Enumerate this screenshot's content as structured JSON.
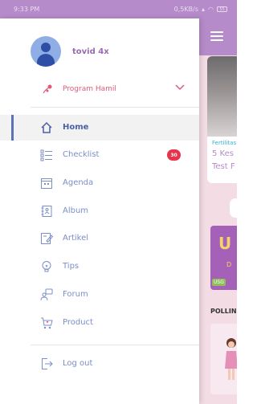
{
  "status_bar": {
    "time": "9:33 PM",
    "network_speed": "0,5KB/s",
    "battery": "55"
  },
  "drawer": {
    "user_name": "tovid 4x",
    "program_label": "Program Hamil",
    "nav_items": [
      {
        "label": "Home",
        "icon": "home-icon",
        "active": true
      },
      {
        "label": "Checklist",
        "icon": "checklist-icon",
        "badge": "30"
      },
      {
        "label": "Agenda",
        "icon": "calendar-icon"
      },
      {
        "label": "Album",
        "icon": "album-icon"
      },
      {
        "label": "Artikel",
        "icon": "article-icon"
      },
      {
        "label": "Tips",
        "icon": "lightbulb-icon"
      },
      {
        "label": "Forum",
        "icon": "forum-icon"
      },
      {
        "label": "Product",
        "icon": "cart-icon"
      }
    ],
    "logout_label": "Log out"
  },
  "background_app": {
    "card_category": "Fertilitas",
    "card_title_line1": "5 Kes",
    "card_title_line2": "Test F",
    "promo_text": "U",
    "promo_sub": "D",
    "promo_tag": "USG",
    "section_title": "POLLIN"
  },
  "colors": {
    "accent": "#b58bc9",
    "nav_text": "#7b8ec7",
    "badge": "#e8334a",
    "program": "#e05b7a"
  }
}
